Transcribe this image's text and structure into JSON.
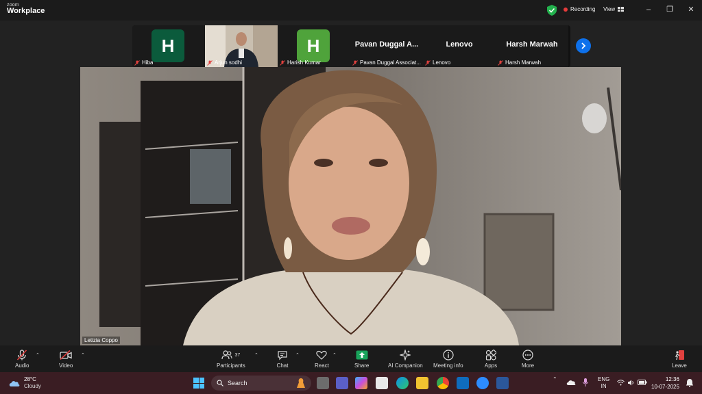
{
  "window": {
    "logo_top": "zoom",
    "logo_bottom": "Workplace",
    "recording_label": "Recording",
    "view_label": "View"
  },
  "filmstrip": {
    "tiles": [
      {
        "type": "avatar",
        "initial": "H",
        "color": "#0b5b3c",
        "caption": "Hiba"
      },
      {
        "type": "video",
        "caption": "Arjun sodhi"
      },
      {
        "type": "avatar",
        "initial": "H",
        "color": "#4fa33b",
        "caption": "Harish Kumar"
      },
      {
        "type": "name",
        "name": "Pavan Duggal A...",
        "caption": "Pavan Duggal Associat..."
      },
      {
        "type": "name",
        "name": "Lenovo",
        "caption": "Lenovo"
      },
      {
        "type": "name",
        "name": "Harsh Marwah",
        "caption": "Harsh Marwah"
      }
    ]
  },
  "main_video": {
    "speaker_name": "Letizia Coppo"
  },
  "toolbar": {
    "audio": "Audio",
    "video": "Video",
    "participants": "Participants",
    "participants_count": "37",
    "chat": "Chat",
    "react": "React",
    "share": "Share",
    "ai_companion": "AI Companion",
    "meeting_info": "Meeting info",
    "apps": "Apps",
    "more": "More",
    "leave": "Leave"
  },
  "taskbar": {
    "temperature": "28°C",
    "weather": "Cloudy",
    "search_placeholder": "Search",
    "lang_top": "ENG",
    "lang_bottom": "IN",
    "time": "12:36",
    "date": "10-07-2025"
  },
  "colors": {
    "accent_blue": "#0e71eb",
    "record_red": "#e53b3b",
    "share_green": "#19a45b",
    "mute_red": "#e0413f"
  }
}
